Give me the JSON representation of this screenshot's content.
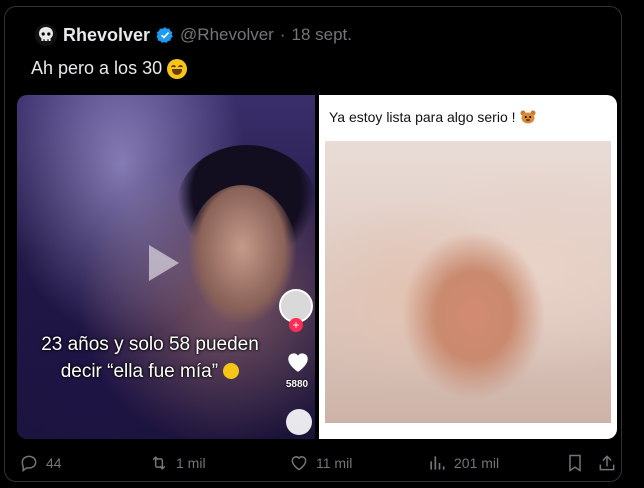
{
  "tweet": {
    "author_name": "Rhevolver",
    "handle": "@Rhevolver",
    "separator": "·",
    "date": "18 sept.",
    "text": "Ah pero a los 30",
    "text_emoji": "grinning-sweat-emoji"
  },
  "media": {
    "left": {
      "caption_line1": "23 años y solo 58 pueden",
      "caption_line2": "decir “ella fue mía”",
      "like_count": "5880",
      "icons": [
        "play-icon",
        "heart-icon",
        "comment-icon"
      ]
    },
    "right": {
      "caption": "Ya estoy lista para algo serio !",
      "caption_emoji": "bear-icon"
    }
  },
  "actions": {
    "replies": "44",
    "retweets": "1 mil",
    "likes": "11 mil",
    "views": "201 mil"
  },
  "colors": {
    "background": "#000000",
    "text": "#e7e9ea",
    "muted": "#71767b",
    "verified": "#1d9bf0",
    "border": "#2f3336"
  }
}
